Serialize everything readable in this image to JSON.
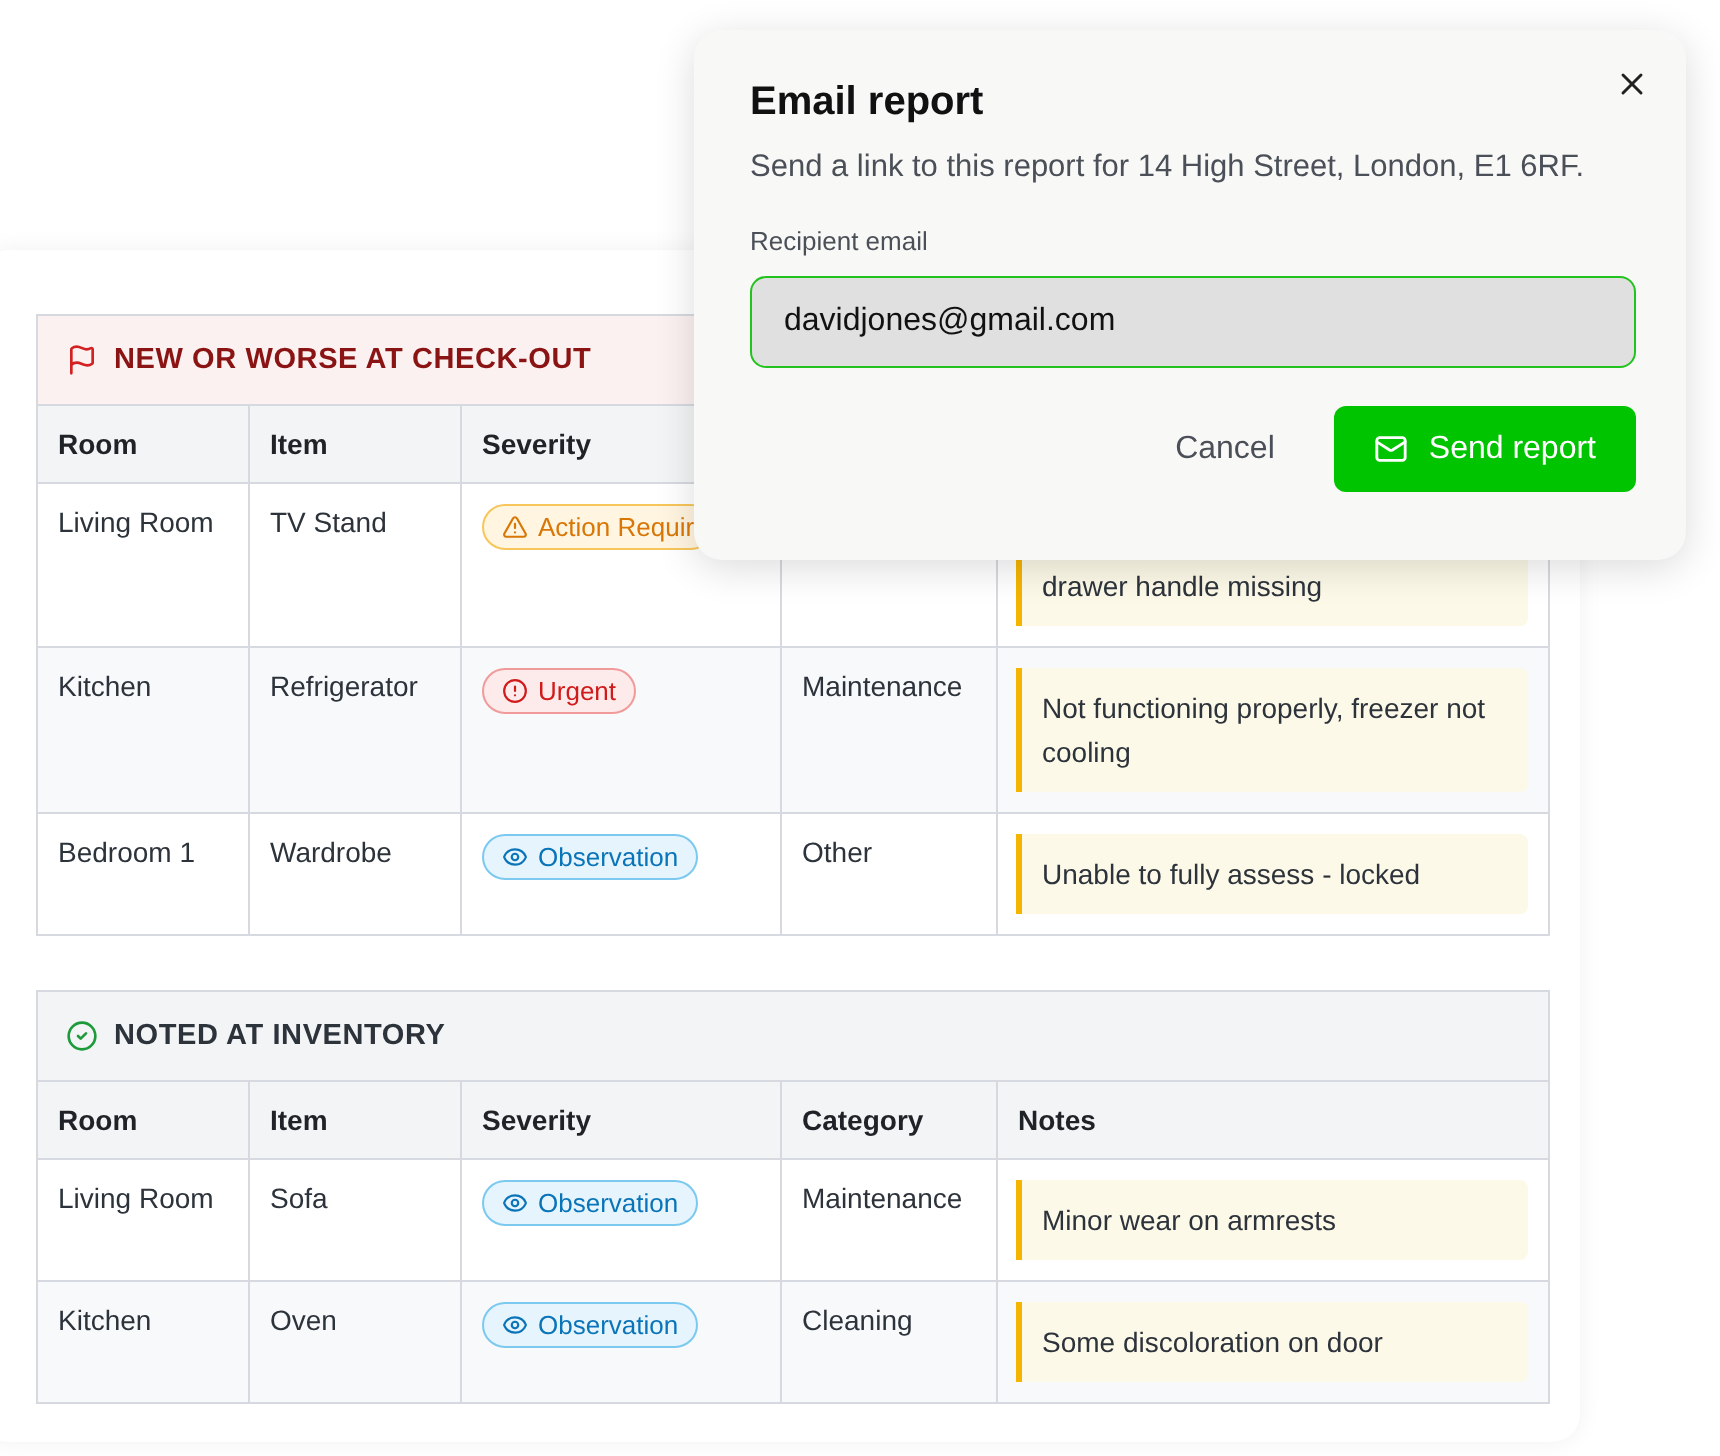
{
  "sections": [
    {
      "kind": "alert",
      "title": "NEW OR WORSE AT CHECK-OUT",
      "columns": [
        "Room",
        "Item",
        "Severity"
      ],
      "rows": [
        {
          "room": "Living Room",
          "item": "TV Stand",
          "severity": {
            "kind": "action",
            "label": "Action Requir"
          },
          "notes": "drawer handle missing",
          "covered": true
        },
        {
          "room": "Kitchen",
          "item": "Refrigerator",
          "severity": {
            "kind": "urgent",
            "label": "Urgent"
          },
          "category": "Maintenance",
          "notes": "Not functioning properly, freezer not cooling",
          "covered": false
        },
        {
          "room": "Bedroom 1",
          "item": "Wardrobe",
          "severity": {
            "kind": "observation",
            "label": "Observation"
          },
          "category": "Other",
          "notes": "Unable to fully assess - locked",
          "covered": false
        }
      ]
    },
    {
      "kind": "ok",
      "title": "NOTED AT INVENTORY",
      "columns": [
        "Room",
        "Item",
        "Severity",
        "Category",
        "Notes"
      ],
      "rows": [
        {
          "room": "Living Room",
          "item": "Sofa",
          "severity": {
            "kind": "observation",
            "label": "Observation"
          },
          "category": "Maintenance",
          "notes": "Minor wear on armrests",
          "covered": false
        },
        {
          "room": "Kitchen",
          "item": "Oven",
          "severity": {
            "kind": "observation",
            "label": "Observation"
          },
          "category": "Cleaning",
          "notes": "Some discoloration on door",
          "covered": false
        }
      ]
    }
  ],
  "dialog": {
    "title": "Email report",
    "description": "Send a link to this report for 14 High Street, London, E1 6RF.",
    "field_label": "Recipient email",
    "value": "davidjones@gmail.com",
    "cancel": "Cancel",
    "submit": "Send report"
  }
}
